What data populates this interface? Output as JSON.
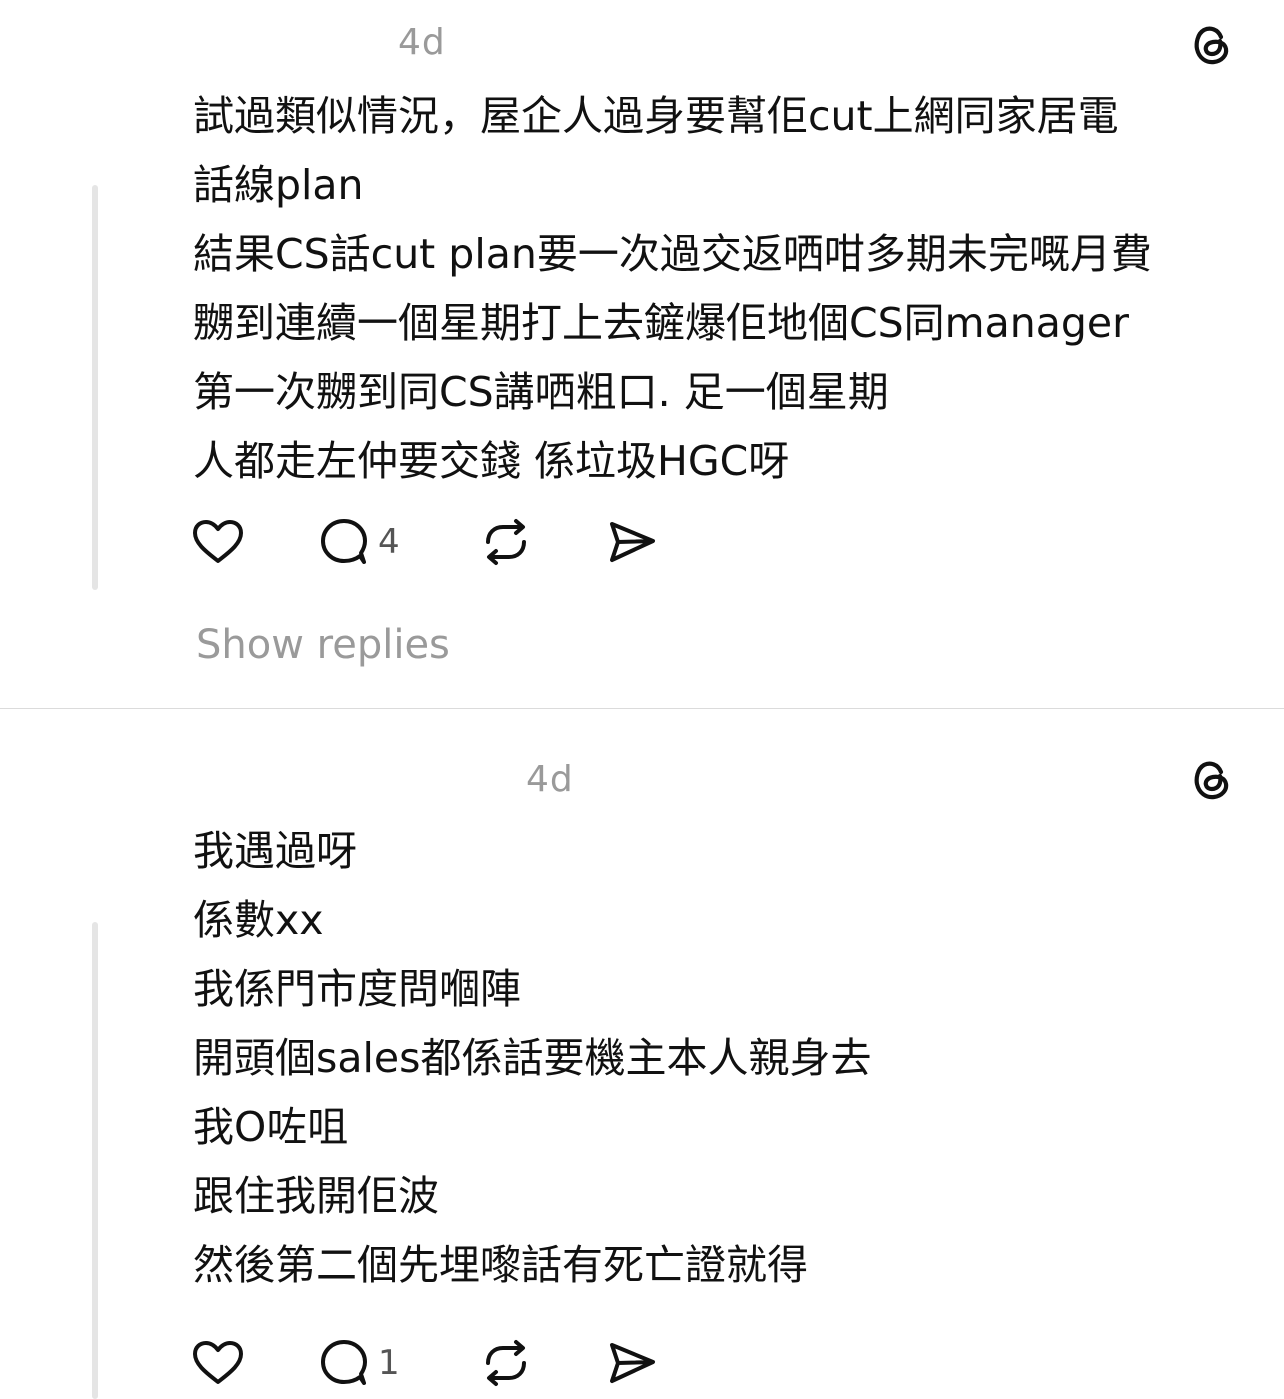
{
  "posts": [
    {
      "timestamp": "4d",
      "logo_icon": "threads-logo-icon",
      "lines": [
        "試過類似情況，屋企人過身要幫佢cut上網同家居電",
        "話線plan",
        "結果CS話cut plan要一次過交返哂咁多期未完嘅月費",
        "嬲到連續一個星期打上去鏟爆佢地個CS同manager",
        "第一次嬲到同CS講哂粗口.    足一個星期",
        "人都走左仲要交錢 係垃圾HGC呀"
      ],
      "actions": {
        "like_icon": "heart-icon",
        "reply_icon": "comment-icon",
        "reply_count": "4",
        "repost_icon": "repost-icon",
        "share_icon": "send-icon"
      },
      "show_replies": "Show replies"
    },
    {
      "timestamp": "4d",
      "logo_icon": "threads-logo-icon",
      "lines": [
        "我遇過呀",
        "係數xx",
        "我係門市度問嗰陣",
        "開頭個sales都係話要機主本人親身去",
        "我O咗咀",
        "跟住我開佢波",
        "然後第二個先埋嚟話有死亡證就得"
      ],
      "actions": {
        "like_icon": "heart-icon",
        "reply_icon": "comment-icon",
        "reply_count": "1",
        "repost_icon": "repost-icon",
        "share_icon": "send-icon"
      }
    }
  ]
}
